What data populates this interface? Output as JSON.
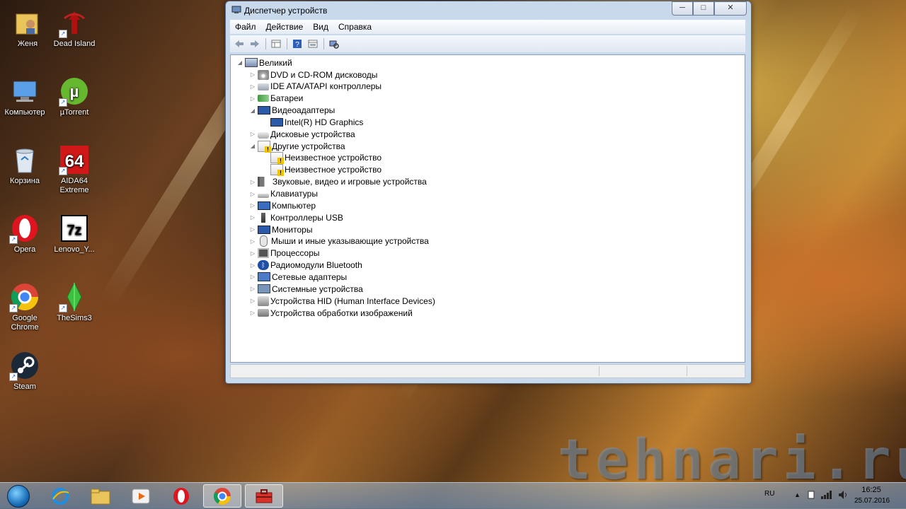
{
  "desktop": {
    "icons": [
      {
        "label": "Женя",
        "icon": "folder-user-icon"
      },
      {
        "label": "Dead Island",
        "icon": "dead-island-icon"
      },
      {
        "label": "Компьютер",
        "icon": "computer-icon"
      },
      {
        "label": "µTorrent",
        "icon": "utorrent-icon"
      },
      {
        "label": "Корзина",
        "icon": "recycle-bin-icon"
      },
      {
        "label": "AIDA64 Extreme",
        "icon": "aida64-icon",
        "badge": "64"
      },
      {
        "label": "Opera",
        "icon": "opera-icon"
      },
      {
        "label": "Lenovo_Y...",
        "icon": "7zip-archive-icon",
        "badge": "7z"
      },
      {
        "label": "Google Chrome",
        "icon": "chrome-icon"
      },
      {
        "label": "TheSims3",
        "icon": "sims3-icon"
      },
      {
        "label": "Steam",
        "icon": "steam-icon"
      }
    ]
  },
  "window": {
    "title": "Диспетчер устройств",
    "controls": {
      "minimize": "─",
      "maximize": "□",
      "close": "✕"
    },
    "menu": [
      "Файл",
      "Действие",
      "Вид",
      "Справка"
    ],
    "toolbar": [
      "back-icon",
      "forward-icon",
      "show-hide-tree-icon",
      "help-icon",
      "properties-icon",
      "scan-hardware-icon"
    ],
    "tree": {
      "root": "Великий",
      "items": [
        {
          "label": "DVD и CD-ROM дисководы",
          "icon": "dvd",
          "expanded": false,
          "level": 1
        },
        {
          "label": "IDE ATA/ATAPI контроллеры",
          "icon": "ide",
          "expanded": false,
          "level": 1
        },
        {
          "label": "Батареи",
          "icon": "bat",
          "expanded": false,
          "level": 1
        },
        {
          "label": "Видеоадаптеры",
          "icon": "mon",
          "expanded": true,
          "level": 1
        },
        {
          "label": "Intel(R) HD Graphics",
          "icon": "mon",
          "level": 2
        },
        {
          "label": "Дисковые устройства",
          "icon": "disk",
          "expanded": false,
          "level": 1
        },
        {
          "label": "Другие устройства",
          "icon": "warn",
          "expanded": true,
          "level": 1
        },
        {
          "label": "Неизвестное устройство",
          "icon": "warn",
          "level": 2
        },
        {
          "label": "Неизвестное устройство",
          "icon": "warn",
          "level": 2
        },
        {
          "label": "Звуковые, видео и игровые устройства",
          "icon": "snd",
          "expanded": false,
          "level": 1
        },
        {
          "label": "Клавиатуры",
          "icon": "kbd",
          "expanded": false,
          "level": 1
        },
        {
          "label": "Компьютер",
          "icon": "comp",
          "expanded": false,
          "level": 1
        },
        {
          "label": "Контроллеры USB",
          "icon": "usb",
          "expanded": false,
          "level": 1
        },
        {
          "label": "Мониторы",
          "icon": "mon",
          "expanded": false,
          "level": 1
        },
        {
          "label": "Мыши и иные указывающие устройства",
          "icon": "mouse",
          "expanded": false,
          "level": 1
        },
        {
          "label": "Процессоры",
          "icon": "cpu",
          "expanded": false,
          "level": 1
        },
        {
          "label": "Радиомодули Bluetooth",
          "icon": "bt",
          "expanded": false,
          "level": 1
        },
        {
          "label": "Сетевые адаптеры",
          "icon": "net",
          "expanded": false,
          "level": 1
        },
        {
          "label": "Системные устройства",
          "icon": "sys",
          "expanded": false,
          "level": 1
        },
        {
          "label": "Устройства HID (Human Interface Devices)",
          "icon": "hid",
          "expanded": false,
          "level": 1
        },
        {
          "label": "Устройства обработки изображений",
          "icon": "img",
          "expanded": false,
          "level": 1
        }
      ]
    }
  },
  "watermark": "tehnari.ru",
  "taskbar": {
    "pinned": [
      "start-orb-icon",
      "internet-explorer-icon",
      "explorer-folder-icon",
      "media-player-icon",
      "opera-icon",
      "chrome-icon",
      "device-manager-icon"
    ],
    "tray": {
      "language": "RU",
      "time": "16:25",
      "date": "25.07.2016"
    }
  },
  "colors": {
    "window_frame": "#c9d9ec",
    "accent": "#1a6fb8"
  }
}
